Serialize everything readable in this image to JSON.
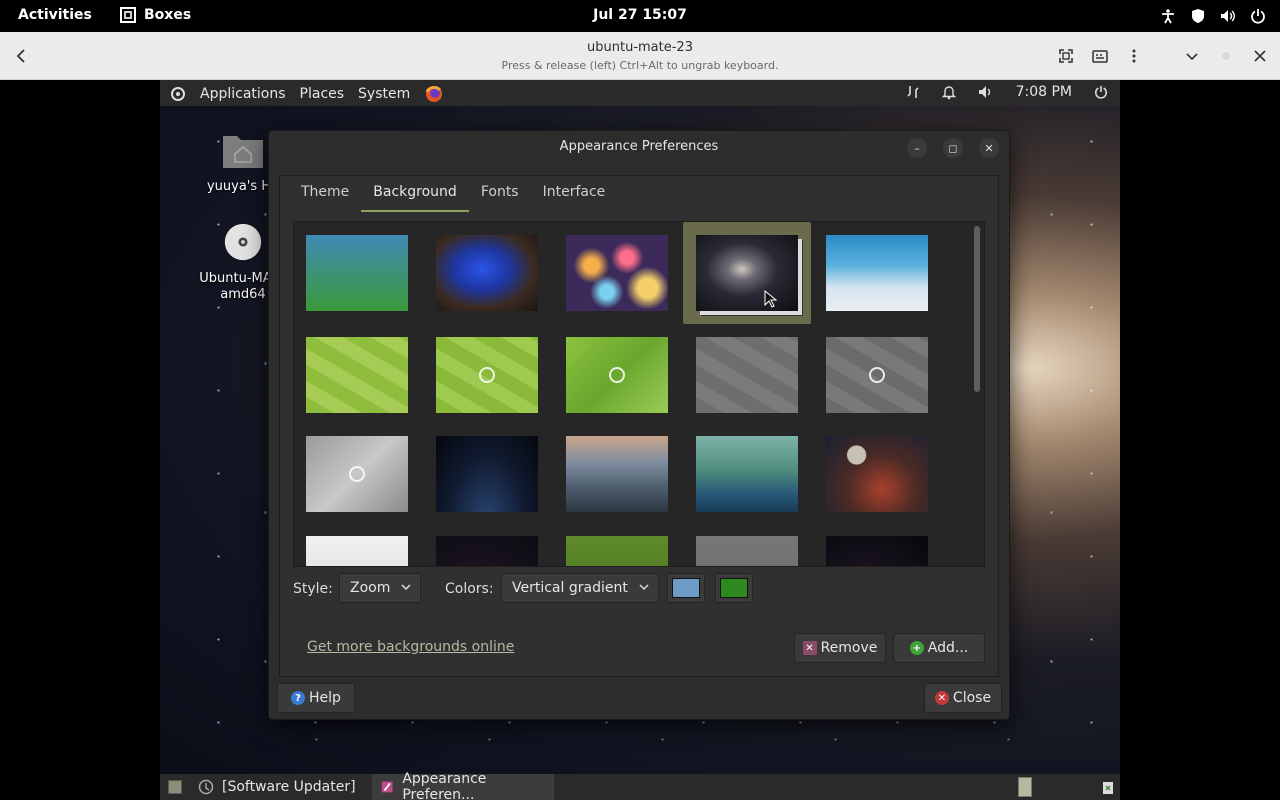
{
  "gnome_bar": {
    "activities": "Activities",
    "app_name": "Boxes",
    "clock": "Jul 27  15:07"
  },
  "boxes_header": {
    "title": "ubuntu-mate-23",
    "subtitle": "Press & release (left) Ctrl+Alt to ungrab keyboard."
  },
  "mate_panel": {
    "menus": [
      "Applications",
      "Places",
      "System"
    ],
    "time": "7:08 PM"
  },
  "desktop": {
    "home_label": "yuuya's Ho",
    "dvd_label_line1": "Ubuntu-MATE",
    "dvd_label_line2": "amd64"
  },
  "window": {
    "title": "Appearance Preferences",
    "tabs": [
      "Theme",
      "Background",
      "Fonts",
      "Interface"
    ],
    "active_tab": "Background",
    "style_label": "Style:",
    "style_value": "Zoom",
    "colors_label": "Colors:",
    "colors_value": "Vertical gradient",
    "color1": "#6d9bc8",
    "color2": "#2e8a1f",
    "more_link": "Get more backgrounds online",
    "remove_label": "Remove",
    "add_label": "Add...",
    "help_label": "Help",
    "close_label": "Close"
  },
  "wallpapers": [
    {
      "name": "gradient-blue-green",
      "bg": "linear-gradient(#3f8ab5,#3a9a3a)"
    },
    {
      "name": "blue-crayfish",
      "bg": "radial-gradient(ellipse at 45% 45%,#2a55e8 0%,#1e36a0 35%,#3b2b22 65%,#181512 100%)"
    },
    {
      "name": "bokeh-lights",
      "bg": "radial-gradient(circle at 25% 40%,#f6b04a 8%,transparent 20%),radial-gradient(circle at 60% 30%,#ff6e8a 8%,transparent 20%),radial-gradient(circle at 80% 70%,#f5d06a 10%,transparent 22%),radial-gradient(circle at 40% 75%,#7bd0f0 8%,transparent 20%),#3c2b5a"
    },
    {
      "name": "spiral-galaxy",
      "bg": "radial-gradient(ellipse at 45% 45%,#cfc7c0 0%,#6d6a73 18%,#2a2a35 45%,#0c0c12 100%)",
      "selected": true
    },
    {
      "name": "ocean-ice",
      "bg": "linear-gradient(#2a8bc6 0%,#5bb1de 40%,#d8e6ef 70%,#e8eef2 100%)"
    },
    {
      "name": "green-poly-1",
      "bg": "repeating-linear-gradient(30deg,#8fbe3c 0 14px,#a6cc55 14px 28px)"
    },
    {
      "name": "green-poly-logo",
      "bg": "repeating-linear-gradient(30deg,#8bba3a 0 14px,#9fca50 14px 28px)",
      "logo": true
    },
    {
      "name": "green-poly-round",
      "bg": "linear-gradient(135deg,#8dc33f,#6aa72e,#9bcd55)",
      "logo": true
    },
    {
      "name": "grey-poly-1",
      "bg": "repeating-linear-gradient(30deg,#6e6e6e 0 14px,#7b7b7b 14px 28px)"
    },
    {
      "name": "grey-poly-logo",
      "bg": "repeating-linear-gradient(30deg,#6b6b6b 0 14px,#797979 14px 28px)",
      "logo": true
    },
    {
      "name": "grey-poly-round",
      "bg": "linear-gradient(135deg,#9a9a9a,#c8c8c8,#8a8a8a)",
      "logo": true
    },
    {
      "name": "earth-night",
      "bg": "radial-gradient(ellipse at 50% 120%,#2b4a78 0%,#101a30 55%,#05070d 100%)"
    },
    {
      "name": "valley-mountains",
      "bg": "linear-gradient(#c9a58a 0%,#7f8ea0 35%,#4b5a6b 70%,#2d3742 100%)"
    },
    {
      "name": "birds-lake",
      "bg": "linear-gradient(#7fb4a8 0%,#4f8d7d 45%,#2a5a7a 75%,#173a55 100%)"
    },
    {
      "name": "crab-moon",
      "bg": "radial-gradient(circle at 30% 25%,#c8c0b2 0 10%,transparent 11%),radial-gradient(ellipse at 55% 70%,#a8412d 0%,#4a2a25 45%,#1b2033 100%)"
    },
    {
      "name": "white-sketch",
      "bg": "linear-gradient(#f0f0f0,#d8d8d8)"
    },
    {
      "name": "red-planet",
      "bg": "radial-gradient(circle at 40% 90%,#b7453a 0 30%,#1a1420 32%,#0d0b12 100%)"
    },
    {
      "name": "green-dots",
      "bg": "linear-gradient(#5f8a2a,#4a7424)"
    },
    {
      "name": "grey-texture",
      "bg": "linear-gradient(#777,#6a6a6a)"
    },
    {
      "name": "spaceship",
      "bg": "radial-gradient(ellipse at 40% 90%,#c05a3a 0 25%,#1a1420 30%,#07070c 100%)"
    }
  ],
  "taskbar": {
    "items": [
      "[Software Updater]",
      "Appearance Preferen..."
    ]
  }
}
